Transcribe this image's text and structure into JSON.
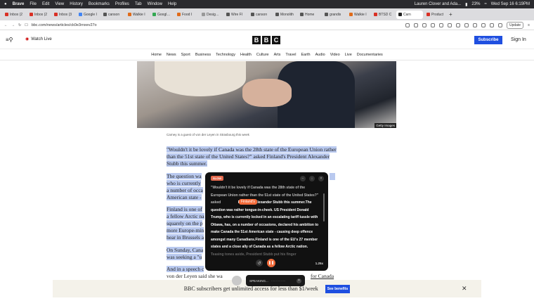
{
  "menubar": {
    "apple": "",
    "app": "Brave",
    "items": [
      "File",
      "Edit",
      "View",
      "History",
      "Bookmarks",
      "Profiles",
      "Tab",
      "Window",
      "Help"
    ],
    "status_user": "Lauren Clover and Ada...",
    "status_pct": "23%",
    "datetime": "Wed Sep 16 6:19PM"
  },
  "tabs": [
    {
      "label": "Inbox (2",
      "color": "#d93025"
    },
    {
      "label": "Inbox (2",
      "color": "#d93025"
    },
    {
      "label": "Inbox (3",
      "color": "#d93025"
    },
    {
      "label": "Google I",
      "color": "#4285f4"
    },
    {
      "label": "canson",
      "color": "#555"
    },
    {
      "label": "Walkie I",
      "color": "#e06b1a"
    },
    {
      "label": "Google D",
      "color": "#34a853"
    },
    {
      "label": "Food I",
      "color": "#e06b1a"
    },
    {
      "label": "Design Images",
      "color": "#999",
      "active": false
    },
    {
      "label": "Wire FI",
      "color": "#555"
    },
    {
      "label": "canson",
      "color": "#555"
    },
    {
      "label": "Monolith",
      "color": "#555"
    },
    {
      "label": "Home",
      "color": "#555"
    },
    {
      "label": "grandis",
      "color": "#555"
    },
    {
      "label": "Walkie I",
      "color": "#e06b1a"
    },
    {
      "label": "BTSD C",
      "color": "#d93025"
    },
    {
      "label": "Carn",
      "color": "#222",
      "active": true
    },
    {
      "label": "Product",
      "color": "#d93025"
    }
  ],
  "address": {
    "url": "bbc.com/news/articles/ck0e3rnxev27o",
    "update": "Update"
  },
  "bbc": {
    "watch_live": "Watch Live",
    "logo": [
      "B",
      "B",
      "C"
    ],
    "subscribe": "Subscribe",
    "sign_in": "Sign In",
    "nav": [
      "Home",
      "News",
      "Sport",
      "Business",
      "Technology",
      "Health",
      "Culture",
      "Arts",
      "Travel",
      "Earth",
      "Audio",
      "Video",
      "Live",
      "Documentaries"
    ]
  },
  "article": {
    "image_credit": "Getty Images",
    "caption": "Carney is a guest of von der Leyen in Strasbourg this week",
    "p1": "\"Wouldn't it be lovely if Canada was the 28th state of the European Union rather than the 51st state of the United States?\" asked Finland's President Alexander Stubb this summer.",
    "p2a": "The question wa",
    "p2b": "who is currently",
    "p2c": "a number of occa",
    "p2d": "American state -",
    "p3a": "Finland is one of",
    "p3b": "a fellow Arctic na",
    "p3c": "squarely on the p",
    "p3d": "more Europe-min",
    "p3e": "hear in Brussels a",
    "p4a": "On Sunday, Cana",
    "p4b": "was seeking a \"u",
    "p5a": "And in a speech c",
    "p5b": "von der Leyen said she wa",
    "p5c": "for Canada"
  },
  "player": {
    "badge": "SLOW",
    "transcript_pre": "\"Wouldn't it be lovely if Canada was the 28th state of the European Union rather than the 51st state of the United States?\" asked ",
    "highlight_word": "Finland's",
    "transcript_bold": " President Alexander Stubb this summer.The question was rather tongue-in-cheek. US President Donald Trump, who is currently locked in an escalating tariff tussle with Ottawa, has, on a number of occasions, declared his ambition to make Canada the 51st American state - causing deep offence amongst many Canadians.Finland is one of the EU's 27 member states and a close ally of Canada as a fellow Arctic nation.",
    "transcript_post": "Teasing tones aside, President Stubb put his finger",
    "speed": "1.25x"
  },
  "speaking": {
    "label": "SPEAKING...",
    "dots": "· · · · · · · · · · · ·"
  },
  "promo": {
    "message": "BBC subscribers get unlimited access for less than $1/week",
    "button": "See benefits"
  },
  "colors": {
    "bbc_blue": "#1f4fe0",
    "highlight": "#b9c9ef",
    "player_accent": "#f26b3a"
  }
}
